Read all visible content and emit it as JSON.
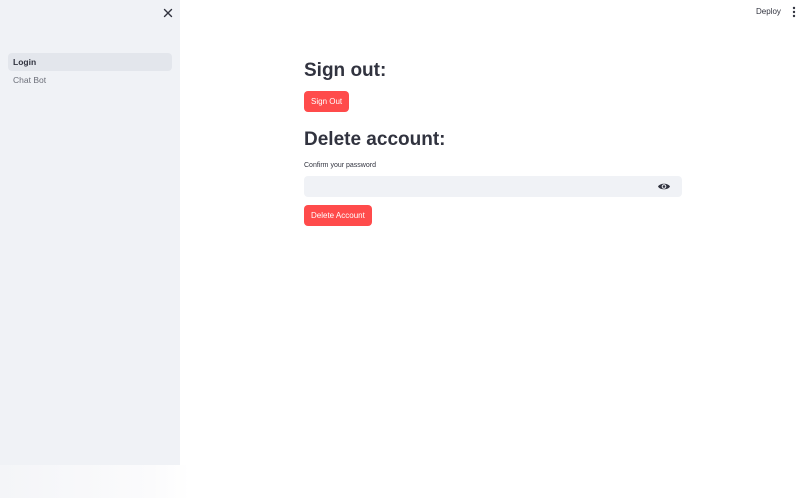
{
  "header": {
    "deploy_label": "Deploy",
    "menu_icon": "kebab-menu-icon"
  },
  "sidebar": {
    "close_icon": "close-icon",
    "items": [
      {
        "label": "Login",
        "active": true
      },
      {
        "label": "Chat Bot",
        "active": false
      }
    ]
  },
  "main": {
    "sign_out": {
      "heading": "Sign out:",
      "button_label": "Sign Out"
    },
    "delete_account": {
      "heading": "Delete account:",
      "password_label": "Confirm your password",
      "password_value": "",
      "password_placeholder": "",
      "button_label": "Delete Account"
    }
  },
  "colors": {
    "accent": "#ff4b4b",
    "sidebar_bg": "#f0f2f6",
    "input_bg": "#f0f2f6",
    "text": "#31333f"
  }
}
